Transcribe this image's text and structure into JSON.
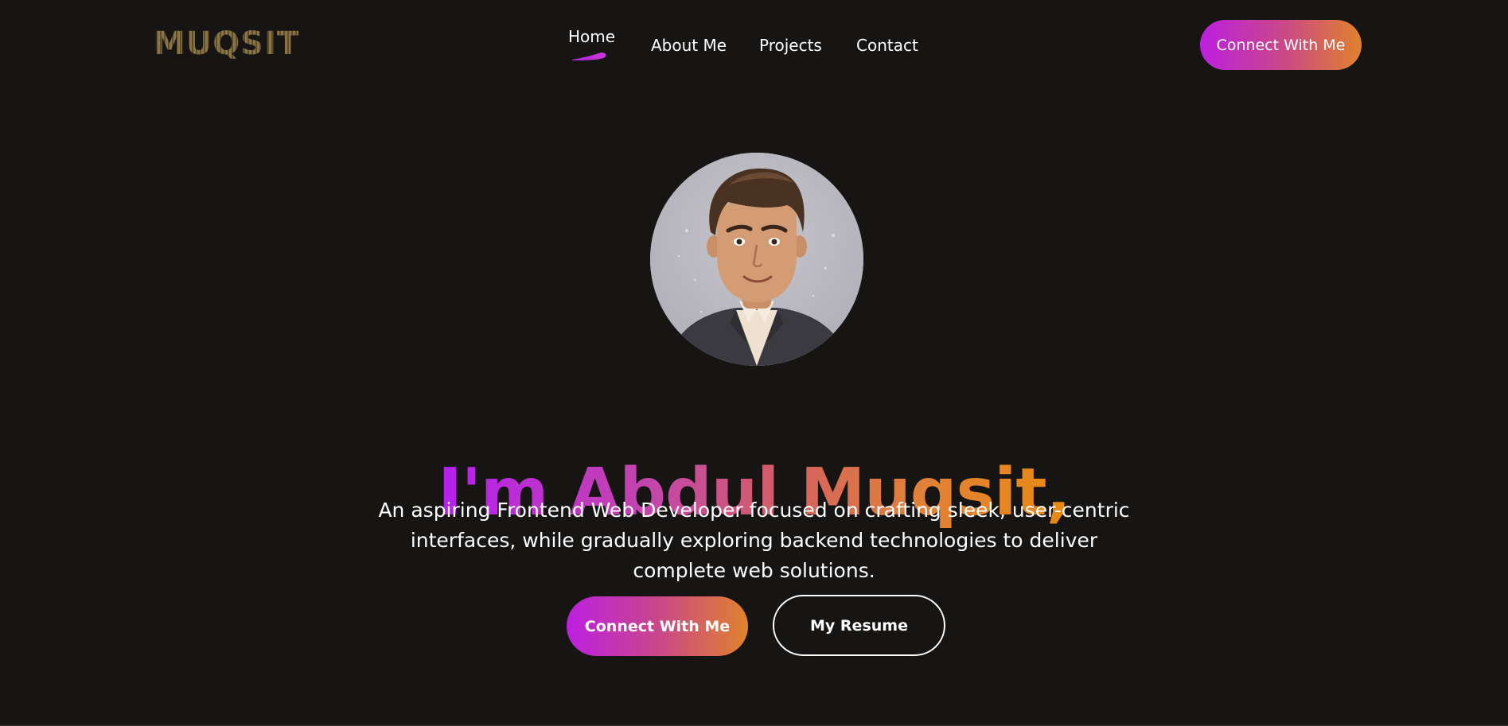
{
  "brand": {
    "logo_text": "MUQSIT"
  },
  "nav": {
    "items": [
      {
        "label": "Home",
        "active": true
      },
      {
        "label": "About Me"
      },
      {
        "label": "Projects"
      },
      {
        "label": "Contact"
      }
    ],
    "cta_label": "Connect With Me"
  },
  "hero": {
    "avatar_icon": "cartoon-portrait-avatar",
    "headline": "I'm Abdul Muqsit,",
    "tagline": "An aspiring Frontend Web Developer focused on crafting sleek, user-centric interfaces, while gradually exploring backend technologies to deliver complete web solutions.",
    "primary_button": "Connect With Me",
    "secondary_button": "My Resume"
  },
  "colors": {
    "background": "#161514",
    "gradient_start": "#bc1fe0",
    "gradient_end": "#e0822c",
    "text": "#ffffff"
  }
}
